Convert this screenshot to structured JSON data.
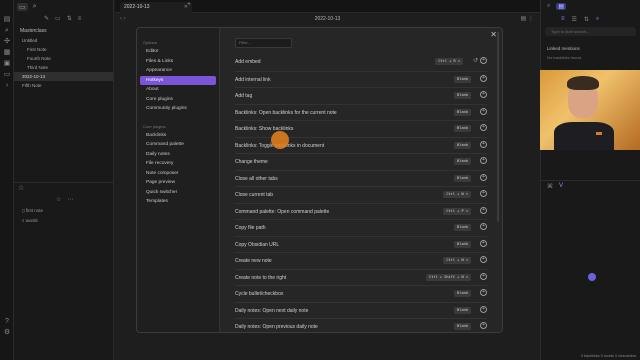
{
  "app": {
    "accent": "#7a55d8",
    "cursor_color": "#e8821e"
  },
  "ribbon": {
    "icons": [
      "files-icon",
      "search-icon",
      "graph-icon",
      "canvas-icon",
      "calendar-icon",
      "template-icon",
      "command-icon"
    ]
  },
  "left_sidebar": {
    "vault_name": "Masterclass",
    "tree": [
      {
        "label": "Untitled",
        "indent": 1,
        "selected": false
      },
      {
        "label": "First Note",
        "indent": 2,
        "selected": false
      },
      {
        "label": "Fourth Note",
        "indent": 2,
        "selected": false
      },
      {
        "label": "Third Note",
        "indent": 2,
        "selected": false
      },
      {
        "label": "2022-10-13",
        "indent": 1,
        "selected": true
      },
      {
        "label": "Fifth Note",
        "indent": 1,
        "selected": false
      }
    ],
    "recent": [
      "first note",
      "words"
    ]
  },
  "tabs": {
    "active_title": "2022-10-13"
  },
  "view_header": {
    "title": "2022-10-13"
  },
  "right_sidebar": {
    "search_placeholder": "Type to start search...",
    "linked_mentions": "Linked mentions",
    "no_backlinks": "No backlinks found.",
    "status": "0 backlinks  0 words  0 characters"
  },
  "settings_modal": {
    "nav_options_heading": "Options",
    "nav_options": [
      "Editor",
      "Files & Links",
      "Appearance",
      "Hotkeys",
      "About",
      "Core plugins",
      "Community plugins"
    ],
    "active_nav": "Hotkeys",
    "nav_core_heading": "Core plugins",
    "nav_core": [
      "Backlinks",
      "Command palette",
      "Daily notes",
      "File recovery",
      "Note composer",
      "Page preview",
      "Quick switcher",
      "Templates"
    ],
    "filter_placeholder": "Filter...",
    "close_label": "✕",
    "hotkeys": [
      {
        "label": "Add embed",
        "keys": "Ctrl + R ✕",
        "extra": true
      },
      {
        "label": "Add internal link",
        "keys": "Blank",
        "extra": false
      },
      {
        "label": "Add tag",
        "keys": "Blank",
        "extra": false
      },
      {
        "label": "Backlinks: Open backlinks for the current note",
        "keys": "Blank",
        "extra": false
      },
      {
        "label": "Backlinks: Show backlinks",
        "keys": "Blank",
        "extra": false
      },
      {
        "label": "Backlinks: Toggle backlinks in document",
        "keys": "Blank",
        "extra": false
      },
      {
        "label": "Change theme",
        "keys": "Blank",
        "extra": false
      },
      {
        "label": "Close all other tabs",
        "keys": "Blank",
        "extra": false
      },
      {
        "label": "Close current tab",
        "keys": "Ctrl + W ✕",
        "extra": false
      },
      {
        "label": "Command palette: Open command palette",
        "keys": "Ctrl + P ✕",
        "extra": false
      },
      {
        "label": "Copy file path",
        "keys": "Blank",
        "extra": false
      },
      {
        "label": "Copy Obsidian URL",
        "keys": "Blank",
        "extra": false
      },
      {
        "label": "Create new note",
        "keys": "Ctrl + N ✕",
        "extra": false
      },
      {
        "label": "Create note to the right",
        "keys": "Ctrl + Shift + N ✕",
        "extra": false
      },
      {
        "label": "Cycle bullet/checkbox",
        "keys": "Blank",
        "extra": false
      },
      {
        "label": "Daily notes: Open next daily note",
        "keys": "Blank",
        "extra": false
      },
      {
        "label": "Daily notes: Open previous daily note",
        "keys": "Blank",
        "extra": false
      }
    ]
  }
}
